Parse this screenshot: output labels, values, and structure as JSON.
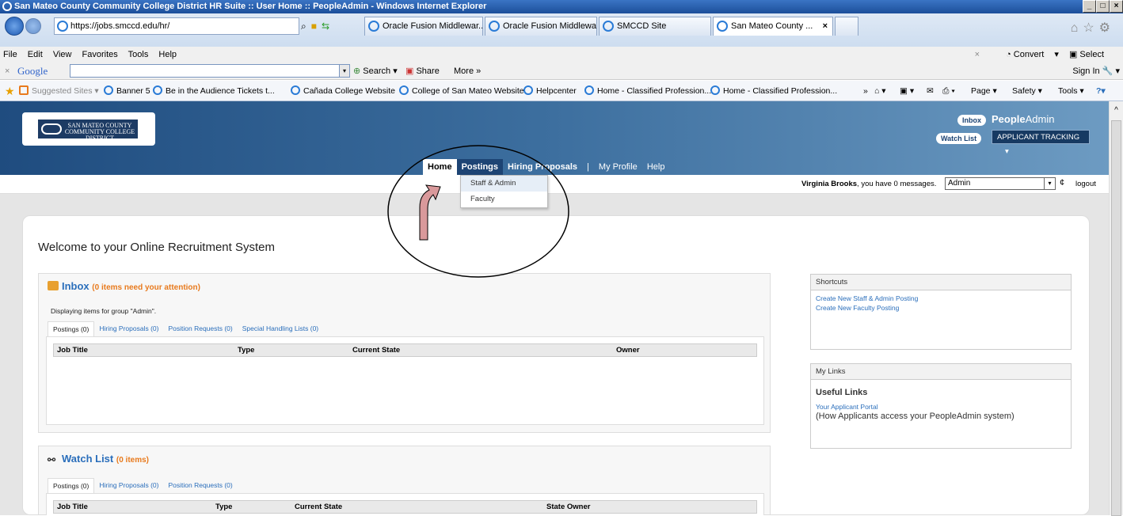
{
  "browser": {
    "window_title": "San Mateo County Community College District HR Suite :: User Home :: PeopleAdmin - Windows Internet Explorer",
    "address": "https://jobs.smccd.edu/hr/",
    "tabs": [
      {
        "label": "Oracle Fusion Middlewar..."
      },
      {
        "label": "Oracle Fusion Middlewar..."
      },
      {
        "label": "SMCCD Site"
      },
      {
        "label": "San Mateo County ..."
      }
    ],
    "menu": [
      "File",
      "Edit",
      "View",
      "Favorites",
      "Tools",
      "Help"
    ],
    "convert": "Convert",
    "select": "Select",
    "google_label": "Google",
    "google_search": "Search",
    "google_share": "Share",
    "google_more": "More »",
    "sign_in": "Sign In",
    "favorites": [
      "Suggested Sites ▾",
      "Banner 5",
      "Be in the Audience Tickets t...",
      "Cañada College Website",
      "College of San Mateo Website",
      "Helpcenter",
      "Home - Classified Profession...",
      "Home - Classified Profession..."
    ],
    "cmd_page": "Page ▾",
    "cmd_safety": "Safety ▾",
    "cmd_tools": "Tools ▾"
  },
  "app": {
    "logo_text": "SAN MATEO COUNTY COMMUNITY COLLEGE DISTRICT",
    "brand_bold": "People",
    "brand_light": "Admin",
    "inbox_btn": "Inbox",
    "watchlist_btn": "Watch List",
    "module": "APPLICANT TRACKING",
    "nav": {
      "home": "Home",
      "postings": "Postings",
      "hiring": "Hiring Proposals",
      "sep": "|",
      "profile": "My Profile",
      "help": "Help"
    },
    "postings_menu": [
      "Staff & Admin",
      "Faculty"
    ],
    "user_name": "Virginia Brooks",
    "user_msg": ", you have 0 messages.",
    "group_select": "Admin",
    "logout": "logout",
    "welcome": "Welcome to your Online Recruitment System",
    "inbox": {
      "title": "Inbox",
      "note": "(0 items need your attention)",
      "group_text": "Displaying items for group \"Admin\".",
      "tabs": [
        "Postings (0)",
        "Hiring Proposals (0)",
        "Position Requests (0)",
        "Special Handling Lists (0)"
      ],
      "columns": [
        "Job Title",
        "Type",
        "Current State",
        "Owner"
      ]
    },
    "watchlist": {
      "title": "Watch List",
      "note": "(0 items)",
      "tabs": [
        "Postings (0)",
        "Hiring Proposals (0)",
        "Position Requests (0)"
      ],
      "columns": [
        "Job Title",
        "Type",
        "Current State",
        "State Owner"
      ]
    },
    "shortcuts": {
      "title": "Shortcuts",
      "links": [
        "Create New Staff & Admin Posting",
        "Create New Faculty Posting"
      ]
    },
    "mylinks": {
      "title": "My Links",
      "heading": "Useful Links",
      "link": "Your Applicant Portal",
      "desc": "(How Applicants access your PeopleAdmin system)"
    }
  }
}
